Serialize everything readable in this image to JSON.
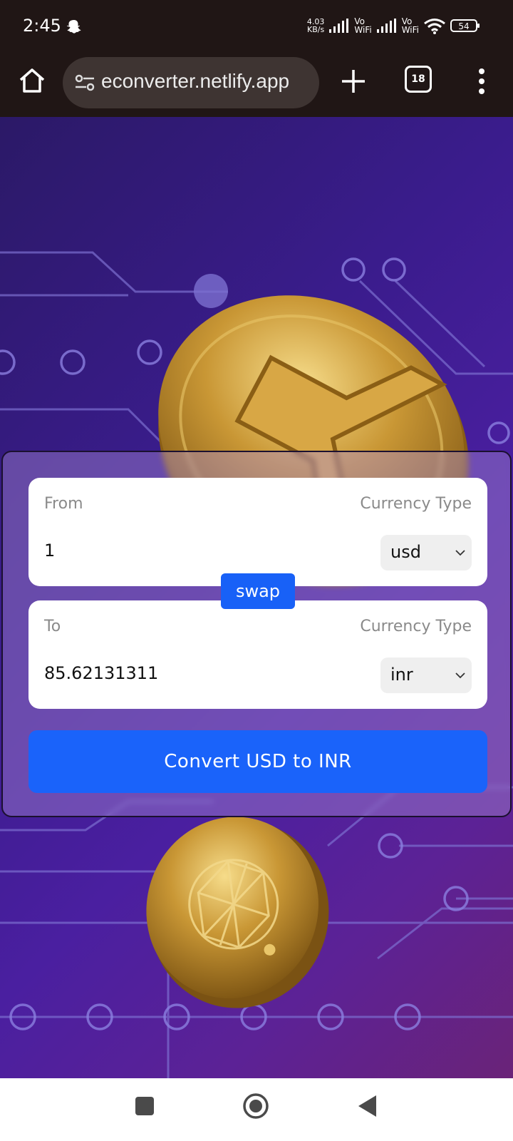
{
  "status_bar": {
    "time": "2:45",
    "net_speed_value": "4.03",
    "net_speed_unit": "KB/s",
    "sim1_label_top": "Vo",
    "sim1_label_bottom": "WiFi",
    "sim2_label_top": "Vo",
    "sim2_label_bottom": "WiFi",
    "battery": "54",
    "icons": [
      "snapchat-icon",
      "signal-icon",
      "wifi-icon",
      "battery-icon"
    ]
  },
  "browser": {
    "url": "econverter.netlify.app",
    "tab_count": "18",
    "icons": [
      "home-icon",
      "site-settings-icon",
      "new-tab-icon",
      "tabs-icon",
      "menu-icon"
    ]
  },
  "converter": {
    "from": {
      "label": "From",
      "currency_type_label": "Currency Type",
      "amount": "1",
      "currency": "usd"
    },
    "to": {
      "label": "To",
      "currency_type_label": "Currency Type",
      "amount": "85.62131311",
      "currency": "inr"
    },
    "swap_label": "swap",
    "convert_label": "Convert USD to INR"
  },
  "colors": {
    "accent_blue": "#1a63fa",
    "status_bar_bg": "#201615",
    "background_purple": "#3a1c8c"
  },
  "nav": {
    "icons": [
      "recents-icon",
      "home-icon",
      "back-icon"
    ]
  }
}
